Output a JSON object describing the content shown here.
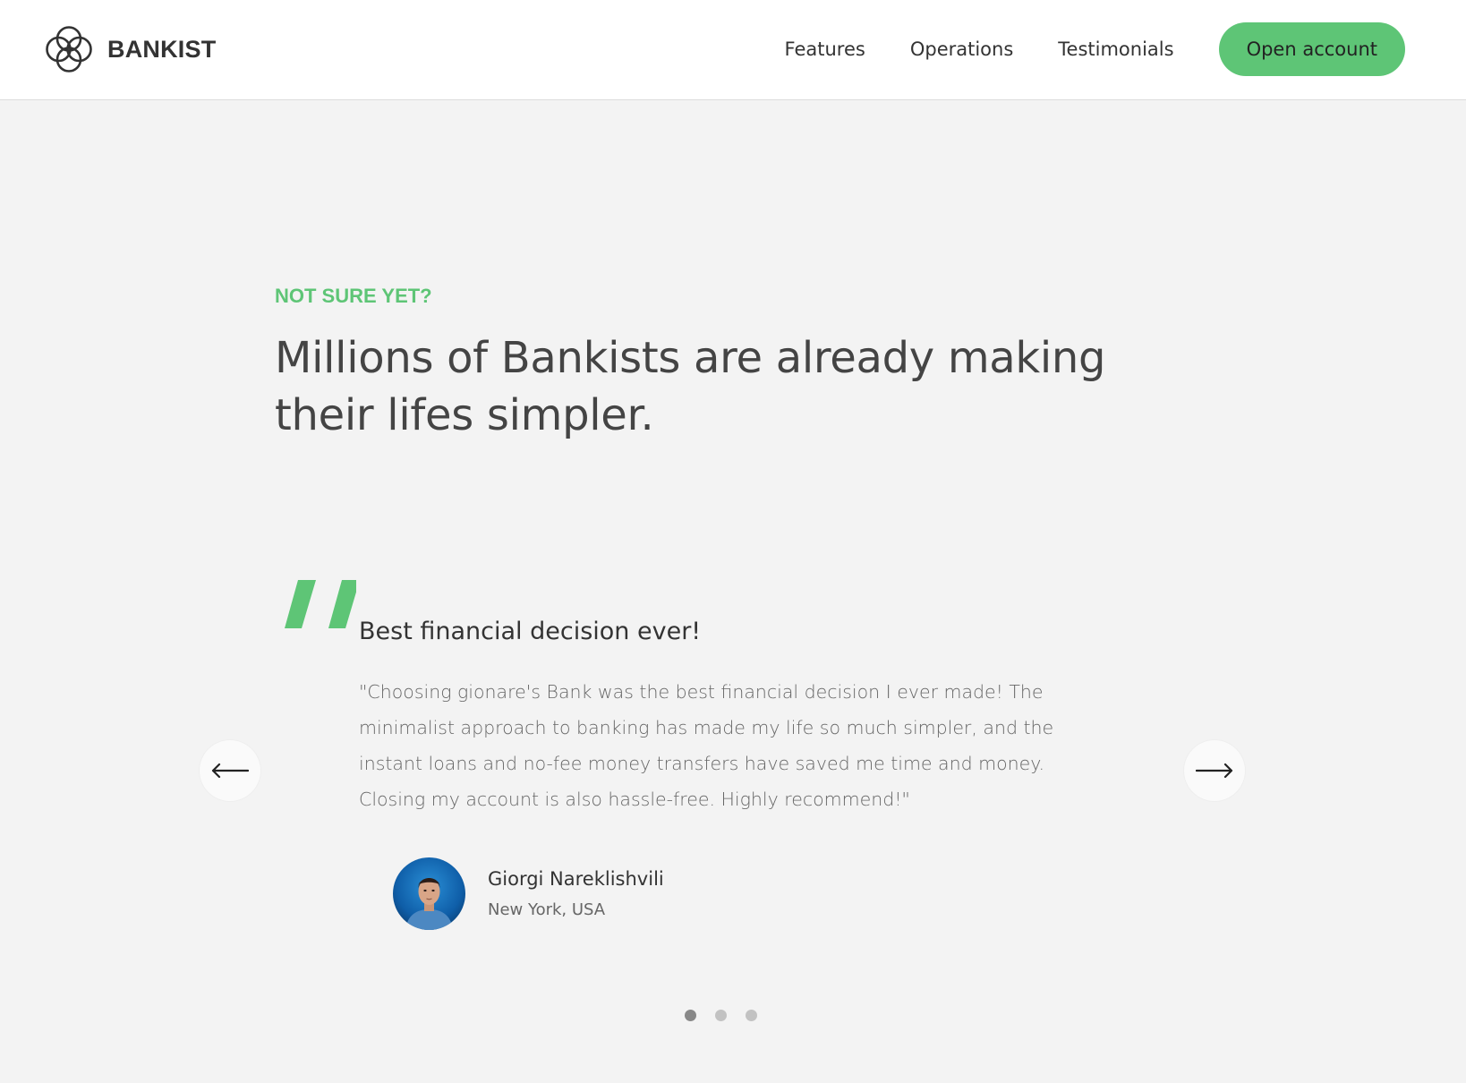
{
  "header": {
    "logo_text": "BANKIST",
    "nav_links": [
      {
        "label": "Features"
      },
      {
        "label": "Operations"
      },
      {
        "label": "Testimonials"
      }
    ],
    "cta_label": "Open account"
  },
  "section": {
    "tag": "NOT SURE YET?",
    "title": "Millions of Bankists are already making their lifes simpler."
  },
  "testimonial": {
    "header": "Best financial decision ever!",
    "text": "\"Choosing gionare's Bank was the best financial decision I ever made! The minimalist approach to banking has made my life so much simpler, and the instant loans and no-fee money transfers have saved me time and money. Closing my account is also hassle-free. Highly recommend!\"",
    "author_name": "Giorgi Nareklishvili",
    "author_location": "New York, USA"
  },
  "slider": {
    "prev_icon": "arrow-left-icon",
    "next_icon": "arrow-right-icon",
    "slide_count": 3,
    "active_slide": 1
  },
  "colors": {
    "accent": "#5ec576",
    "background": "#f3f3f3",
    "header_background": "#ffffff",
    "heading_text": "#444444",
    "body_text": "#666666"
  }
}
